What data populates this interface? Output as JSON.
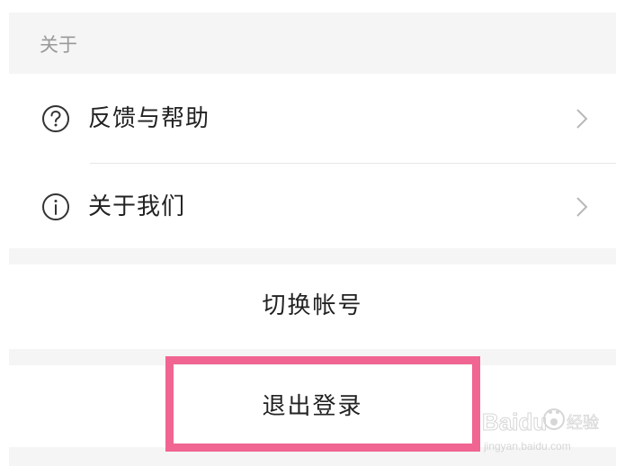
{
  "section": {
    "title": "关于"
  },
  "menu": {
    "items": [
      {
        "label": "反馈与帮助",
        "icon": "question-circle-icon"
      },
      {
        "label": "关于我们",
        "icon": "info-circle-icon"
      }
    ]
  },
  "actions": {
    "switch_account": "切换帐号",
    "logout": "退出登录"
  },
  "watermark": {
    "brand": "Baidu",
    "brand_suffix": "经验",
    "url": "jingyan.baidu.com"
  },
  "colors": {
    "highlight": "#f06592",
    "band": "#f5f5f5",
    "text": "#222222",
    "muted": "#999999"
  }
}
